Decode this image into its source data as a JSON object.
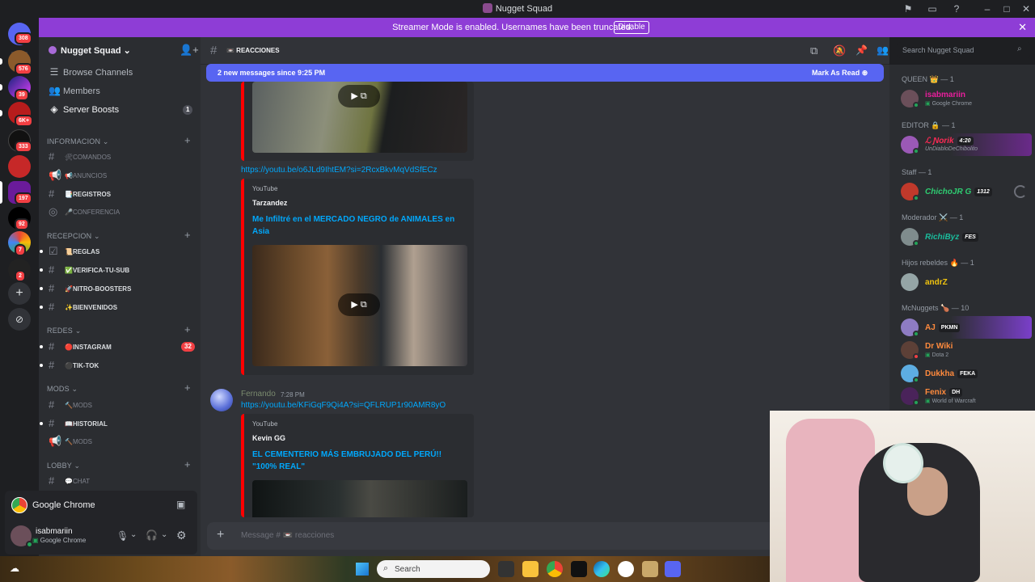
{
  "window": {
    "title": "Nugget Squad"
  },
  "banner": {
    "text": "Streamer Mode is enabled. Usernames have been truncated.",
    "disable_label": "Disable"
  },
  "rail_badges": [
    "308",
    "576",
    "39",
    "6K+",
    "333",
    "197",
    "92",
    "7",
    "2"
  ],
  "sidebar": {
    "server_name": "Nugget Squad",
    "nav": [
      {
        "label": "Browse Channels",
        "icon": "browse-icon"
      },
      {
        "label": "Members",
        "icon": "members-icon"
      },
      {
        "label": "Server Boosts",
        "icon": "boost-icon",
        "badge": "1"
      }
    ],
    "categories": [
      {
        "name": "INFORMACION",
        "channels": [
          {
            "label": "🛠comandos",
            "muted": true,
            "type": "text"
          },
          {
            "label": "📢anuncios",
            "muted": true,
            "type": "announce"
          },
          {
            "label": "📑registros",
            "muted": false,
            "type": "text"
          },
          {
            "label": "🎤conferencia",
            "muted": true,
            "type": "stage"
          }
        ]
      },
      {
        "name": "RECEPCION",
        "channels": [
          {
            "label": "📜reglas",
            "muted": false,
            "unread": true,
            "type": "rules"
          },
          {
            "label": "✅verifica-tu-sub",
            "muted": false,
            "unread": true,
            "type": "text"
          },
          {
            "label": "🚀nitro-boosters",
            "muted": false,
            "unread": true,
            "type": "text"
          },
          {
            "label": "✨bienvenidos",
            "muted": false,
            "unread": true,
            "type": "text"
          }
        ]
      },
      {
        "name": "REDES",
        "channels": [
          {
            "label": "🔴instagram",
            "muted": false,
            "unread": true,
            "type": "text",
            "badge": "32"
          },
          {
            "label": "⚫tik-tok",
            "muted": false,
            "unread": true,
            "type": "text"
          }
        ]
      },
      {
        "name": "MODS",
        "channels": [
          {
            "label": "🔨mods",
            "muted": true,
            "type": "text"
          },
          {
            "label": "📖historial",
            "muted": false,
            "unread": true,
            "type": "text"
          },
          {
            "label": "🔨mods",
            "muted": true,
            "type": "announce"
          }
        ]
      },
      {
        "name": "LOBBY",
        "channels": [
          {
            "label": "💬chat",
            "muted": true,
            "type": "text"
          }
        ]
      }
    ],
    "voice_activity": "Google Chrome",
    "user": {
      "name": "isabmariin",
      "activity": "Google Chrome"
    }
  },
  "chat": {
    "channel_name": "📼 reacciones",
    "search_placeholder": "Search Nugget Squad",
    "new_messages": "2 new messages since 9:25 PM",
    "mark_read": "Mark As Read",
    "link1": "https://youtu.be/o6JLd9IhtEM?si=2RcxBkvMqVdSfECz",
    "embed1": {
      "provider": "YouTube",
      "author": "Tarzandez",
      "title": "Me Infiltré en el MERCADO NEGRO de ANIMALES en Asia"
    },
    "message2": {
      "author": "Fernando",
      "time": "7:28 PM",
      "link": "https://youtu.be/KFiGqF9Qi4A?si=QFLRUP1r90AMR8yO"
    },
    "embed2": {
      "provider": "YouTube",
      "author": "Kevin GG",
      "title": "EL CEMENTERIO MÁS EMBRUJADO DEL PERÚ!! \"100% REAL\""
    },
    "composer_placeholder": "Message # 📼 reacciones"
  },
  "members": {
    "groups": [
      {
        "role": "QUEEN 👑 — 1",
        "items": [
          {
            "name": "isabmariin",
            "color": "#e91e9c",
            "activity": "Google Chrome"
          }
        ]
      },
      {
        "role": "EDITOR 🔒 — 1",
        "items": [
          {
            "name": "ℒ Ɲorik",
            "color": "#ff2a55",
            "tag": "4:20",
            "activity": "UnDiabloDeChibolito"
          }
        ]
      },
      {
        "role": "Staff — 1",
        "items": [
          {
            "name": "ChichoJR G",
            "color": "#2ecc71",
            "tag": "1312"
          }
        ]
      },
      {
        "role": "Moderador ⚔️ — 1",
        "items": [
          {
            "name": "RichiByz",
            "color": "#1abc9c",
            "tag": "FES"
          }
        ]
      },
      {
        "role": "Hijos rebeldes 🔥 — 1",
        "items": [
          {
            "name": "andrZ",
            "color": "#f1c40f"
          }
        ]
      },
      {
        "role": "McNuggets 🍗 — 10",
        "items": [
          {
            "name": "AJ",
            "color": "#ff8a3d",
            "tag": "PKMN"
          },
          {
            "name": "Dr Wiki",
            "color": "#ff8a3d",
            "activity": "Dota 2"
          },
          {
            "name": "Dukkha",
            "color": "#ff8a3d",
            "tag": "FEKA"
          },
          {
            "name": "Fenix",
            "color": "#ff8a3d",
            "tag": "DH",
            "activity": "World of Warcraft"
          }
        ]
      }
    ]
  },
  "taskbar": {
    "search_label": "Search"
  },
  "colors": {
    "accent": "#5865f2",
    "banner": "#8e3dd6",
    "link": "#00a8fc",
    "youtube": "#ff0000"
  }
}
